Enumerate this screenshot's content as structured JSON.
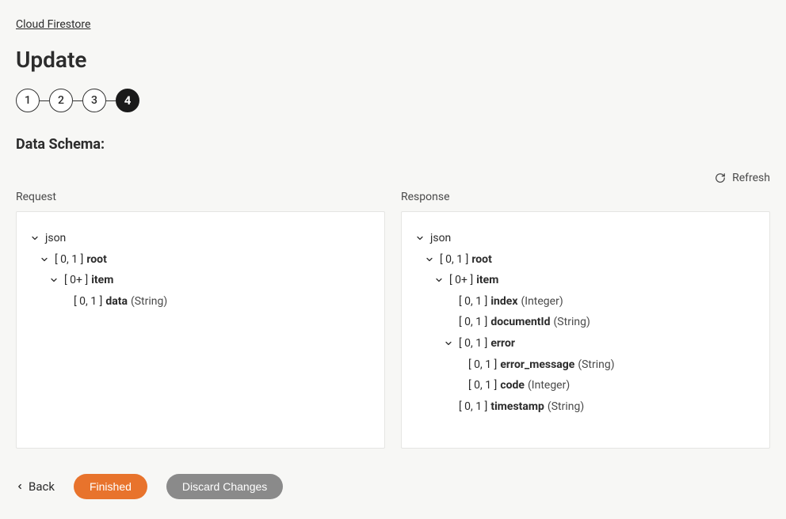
{
  "breadcrumb": "Cloud Firestore",
  "page_title": "Update",
  "stepper": {
    "steps": [
      "1",
      "2",
      "3",
      "4"
    ],
    "active_index": 3
  },
  "section_label": "Data Schema:",
  "refresh_label": "Refresh",
  "request_label": "Request",
  "response_label": "Response",
  "request_tree": {
    "root_label": "json",
    "nodes": [
      {
        "indent": 1,
        "expandable": true,
        "cardinality": "[ 0, 1 ]",
        "name": "root",
        "type": ""
      },
      {
        "indent": 2,
        "expandable": true,
        "cardinality": "[ 0+ ]",
        "name": "item",
        "type": ""
      },
      {
        "indent": 3,
        "expandable": false,
        "cardinality": "[ 0, 1 ]",
        "name": "data",
        "type": "(String)"
      }
    ]
  },
  "response_tree": {
    "root_label": "json",
    "nodes": [
      {
        "indent": 1,
        "expandable": true,
        "cardinality": "[ 0, 1 ]",
        "name": "root",
        "type": ""
      },
      {
        "indent": 2,
        "expandable": true,
        "cardinality": "[ 0+ ]",
        "name": "item",
        "type": ""
      },
      {
        "indent": 3,
        "expandable": false,
        "cardinality": "[ 0, 1 ]",
        "name": "index",
        "type": "(Integer)"
      },
      {
        "indent": 3,
        "expandable": false,
        "cardinality": "[ 0, 1 ]",
        "name": "documentId",
        "type": "(String)"
      },
      {
        "indent": 3,
        "expandable": true,
        "cardinality": "[ 0, 1 ]",
        "name": "error",
        "type": ""
      },
      {
        "indent": 4,
        "expandable": false,
        "cardinality": "[ 0, 1 ]",
        "name": "error_message",
        "type": "(String)"
      },
      {
        "indent": 4,
        "expandable": false,
        "cardinality": "[ 0, 1 ]",
        "name": "code",
        "type": "(Integer)"
      },
      {
        "indent": 3,
        "expandable": false,
        "cardinality": "[ 0, 1 ]",
        "name": "timestamp",
        "type": "(String)"
      }
    ]
  },
  "actions": {
    "back": "Back",
    "finished": "Finished",
    "discard": "Discard Changes"
  }
}
